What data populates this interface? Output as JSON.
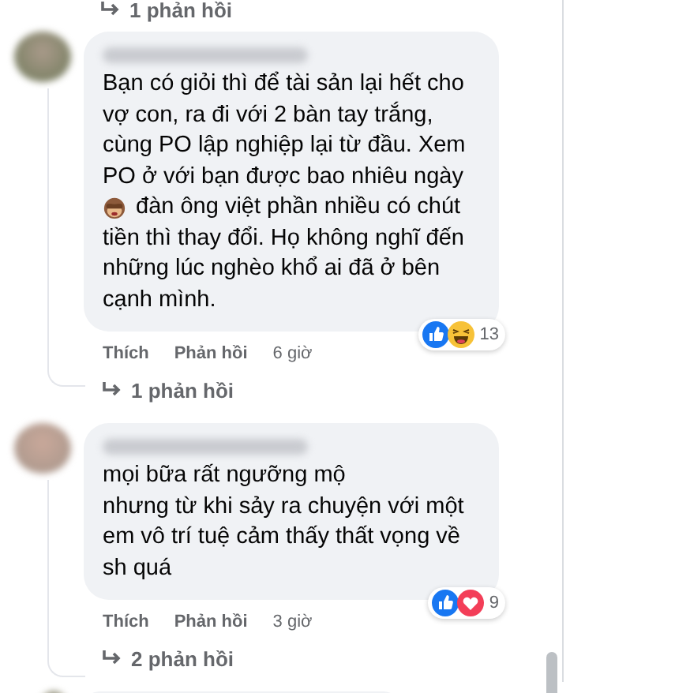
{
  "top_replies_link": "1 phản hồi",
  "comments": [
    {
      "text_before": "Bạn có giỏi thì để tài sản lại hết cho vợ con, ra đi với 2 bàn tay trắng, cùng PO lập nghiệp lại từ đầu. Xem PO ở với bạn được bao nhiêu ngày",
      "emoji": {
        "kind": "monkey",
        "text": "đàn ông việt phần nhiều có chút"
      },
      "text_after": "tiền thì thay đổi. Họ không nghĩ đến những lúc nghèo khổ ai đã ở bên cạnh mình.",
      "actions": [
        "Thích",
        "Phản hồi"
      ],
      "time": "6 giờ",
      "reactions": [
        {
          "kind": "like"
        },
        {
          "kind": "haha"
        }
      ],
      "reaction_count": "13",
      "replies_link": "1 phản hồi"
    },
    {
      "text_before": "mọi bữa rất ngưỡng mộ\nnhưng từ khi sảy ra chuyện với một em vô trí tuệ cảm thấy thất vọng về sh quá",
      "actions": [
        "Thích",
        "Phản hồi"
      ],
      "time": "3 giờ",
      "reactions": [
        {
          "kind": "like"
        },
        {
          "kind": "love"
        }
      ],
      "reaction_count": "9",
      "replies_link": "2 phản hồi"
    }
  ]
}
